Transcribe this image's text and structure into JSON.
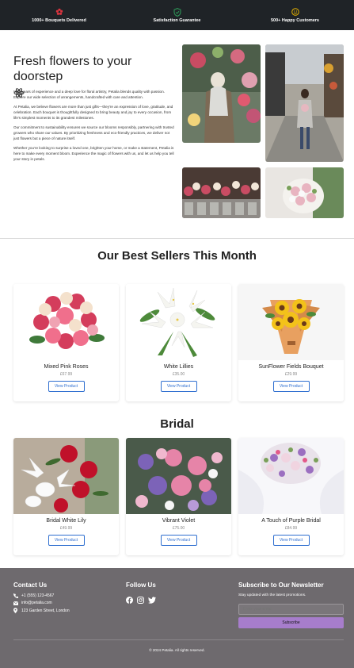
{
  "topbar": {
    "features": [
      {
        "icon": "flower-icon",
        "label": "1000+ Bouquets Delivered"
      },
      {
        "icon": "shield-check-icon",
        "label": "Satisfaction Guarantee"
      },
      {
        "icon": "smile-icon",
        "label": "500+ Happy Customers"
      }
    ]
  },
  "about": {
    "title": "Fresh flowers to your doorstep",
    "title_icon": "atom-icon",
    "paragraphs": [
      "With years of experience and a deep love for floral artistry, Petalia blends quality with passion. Explore our wide selection of arrangements, handcrafted with care and attention.",
      "At Petalia, we believe flowers are more than just gifts—they're an expression of love, gratitude, and celebration. Each bouquet is thoughtfully designed to bring beauty and joy to every occasion, from life's simplest moments to its grandest milestones.",
      "Our commitment to sustainability ensures we source our blooms responsibly, partnering with trusted growers who share our values. By prioritizing freshness and eco-friendly practices, we deliver not just flowers but a piece of nature itself.",
      "Whether you're looking to surprise a loved one, brighten your home, or make a statement, Petalia is here to make every moment bloom. Experience the magic of flowers with us, and let us help you tell your story in petals."
    ]
  },
  "best_sellers": {
    "title": "Our Best Sellers This Month",
    "products": [
      {
        "name": "Mixed Pink Roses",
        "price": "£67.99",
        "button": "View Product"
      },
      {
        "name": "White Lillies",
        "price": "£35.00",
        "button": "View Product"
      },
      {
        "name": "SunFlower Fields Bouquet",
        "price": "£29.99",
        "button": "View Product"
      }
    ]
  },
  "bridal": {
    "title": "Bridal",
    "products": [
      {
        "name": "Bridal White Lily",
        "price": "£49.99",
        "button": "View Product"
      },
      {
        "name": "Vibrant Violet",
        "price": "£75.00",
        "button": "View Product"
      },
      {
        "name": "A Touch of Purple Bridal",
        "price": "£84.99",
        "button": "View Product"
      }
    ]
  },
  "footer": {
    "contact": {
      "heading": "Contact Us",
      "phone": "+1 (555) 123-4567",
      "email": "info@petalia.com",
      "address": "123 Garden Street, London"
    },
    "follow": {
      "heading": "Follow Us",
      "icons": [
        "facebook-icon",
        "instagram-icon",
        "twitter-icon"
      ]
    },
    "newsletter": {
      "heading": "Subscribe to Our Newsletter",
      "subtext": "Stay updated with the latest promotions.",
      "placeholder": "Enter your email",
      "button": "Subscribe"
    },
    "copyright": "© 2024 Petalia. All rights reserved."
  },
  "colors": {
    "topbar_bg": "#1f2327",
    "flower_icon": "#d9343f",
    "shield_icon": "#2e9e5a",
    "smile_icon": "#e8b400",
    "button_blue": "#2f6fd0",
    "footer_bg": "#6e6a6e",
    "subscribe_btn": "#a77dcc"
  }
}
